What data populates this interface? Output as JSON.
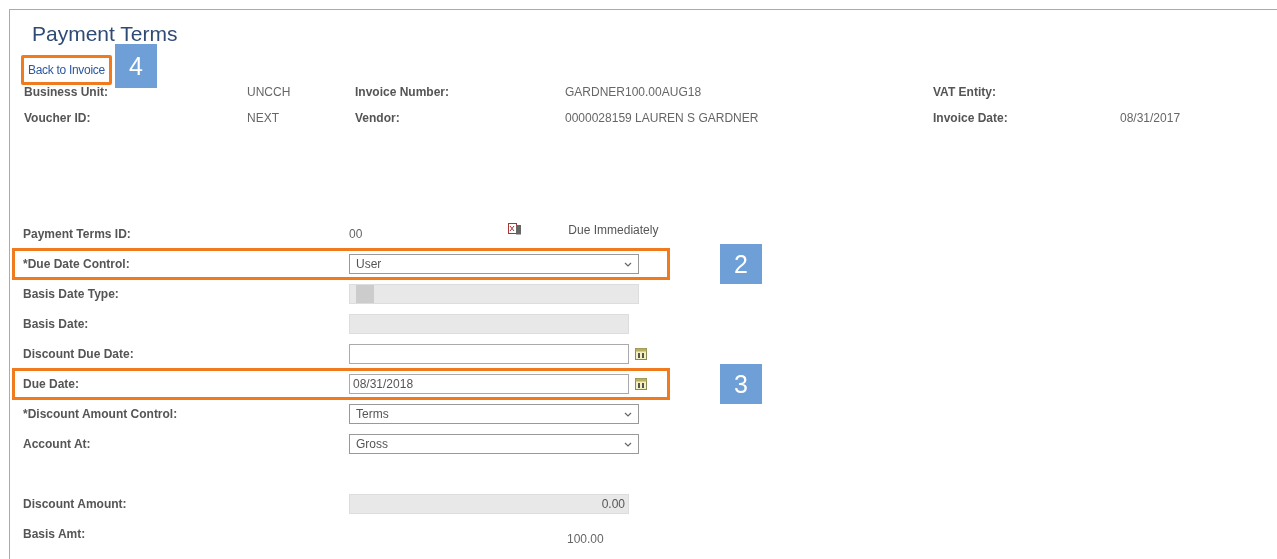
{
  "title": "Payment Terms",
  "back_link": {
    "label": "Back to Invoice",
    "highlighted": true,
    "callout": "4"
  },
  "header": [
    {
      "label": "Business Unit:",
      "value": "UNCCH"
    },
    {
      "label": "Invoice Number:",
      "value": "GARDNER100.00AUG18"
    },
    {
      "label": "VAT Entity:"
    },
    {
      "label": "Voucher ID:",
      "value": "NEXT"
    },
    {
      "label": "Vendor:",
      "value": "0000028159  LAUREN S GARDNER"
    },
    {
      "label": "Invoice Date:",
      "value": "08/31/2017"
    }
  ],
  "fields": [
    {
      "kind": "text",
      "label": "Payment Terms ID:",
      "value": "00",
      "description": "Due Immediately",
      "highlighted": false
    },
    {
      "kind": "select",
      "label": "*Due Date Control:",
      "value": "User",
      "highlighted": true,
      "callout": "2"
    },
    {
      "kind": "select",
      "label": "Basis Date Type:",
      "disabled": true,
      "highlighted": false
    },
    {
      "kind": "input",
      "label": "Basis Date:",
      "disabled": true,
      "highlighted": false
    },
    {
      "kind": "date",
      "label": "Discount Due Date:",
      "highlighted": false
    },
    {
      "kind": "date",
      "label": "Due Date:",
      "value": "08/31/2018",
      "highlighted": true,
      "callout": "3"
    },
    {
      "kind": "select",
      "label": "*Discount Amount Control:",
      "value": "Terms",
      "highlighted": false
    },
    {
      "kind": "select",
      "label": "Account At:",
      "value": "Gross",
      "highlighted": false
    },
    {
      "kind": "amount",
      "label": "Discount Amount:",
      "value": "0.00",
      "disabled": true,
      "highlighted": false
    },
    {
      "kind": "total",
      "label": "Basis Amt:",
      "value": "100.00",
      "highlighted": false
    }
  ]
}
